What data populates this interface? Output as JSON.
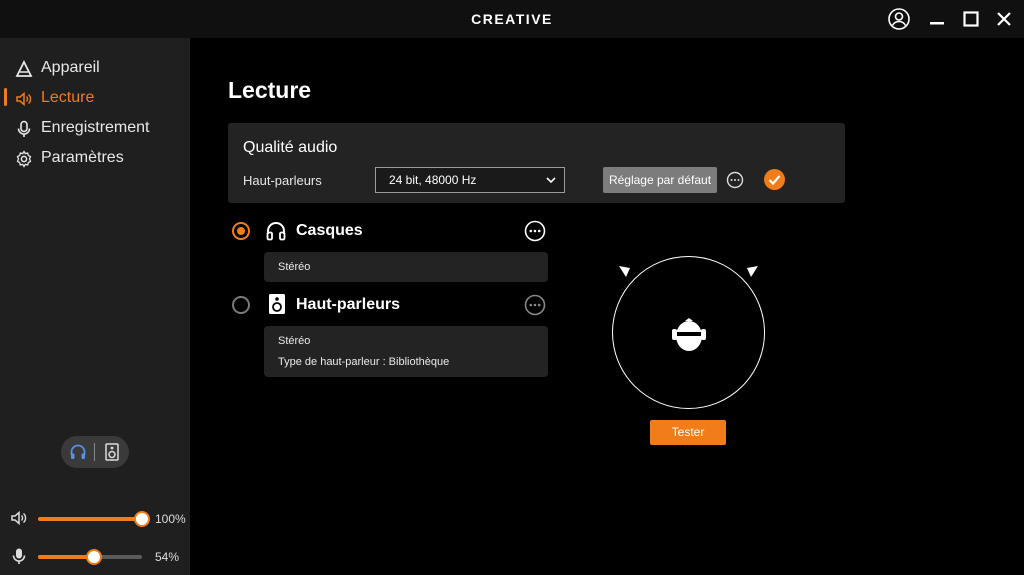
{
  "app": {
    "brand": "CREATIVE"
  },
  "sidebar": {
    "items": [
      {
        "label": "Appareil",
        "icon": "device-icon",
        "active": false
      },
      {
        "label": "Lecture",
        "icon": "speaker-icon",
        "active": true
      },
      {
        "label": "Enregistrement",
        "icon": "microphone-icon",
        "active": false
      },
      {
        "label": "Paramètres",
        "icon": "gear-icon",
        "active": false
      }
    ],
    "volume": {
      "output_percent": 100,
      "output_label": "100%",
      "mic_percent": 54,
      "mic_label": "54%"
    }
  },
  "main": {
    "title": "Lecture",
    "quality": {
      "title": "Qualité audio",
      "label": "Haut-parleurs",
      "selected": "24 bit, 48000 Hz",
      "default_button": "Réglage par défaut"
    },
    "outputs": [
      {
        "name": "Casques",
        "selected": true,
        "details": [
          "Stéréo"
        ]
      },
      {
        "name": "Haut-parleurs",
        "selected": false,
        "details": [
          "Stéréo",
          "Type de haut-parleur : Bibliothèque"
        ]
      }
    ],
    "test_button": "Tester"
  },
  "colors": {
    "accent": "#f07c1a",
    "sidebar": "#1f1f1f",
    "panel": "#232323"
  }
}
